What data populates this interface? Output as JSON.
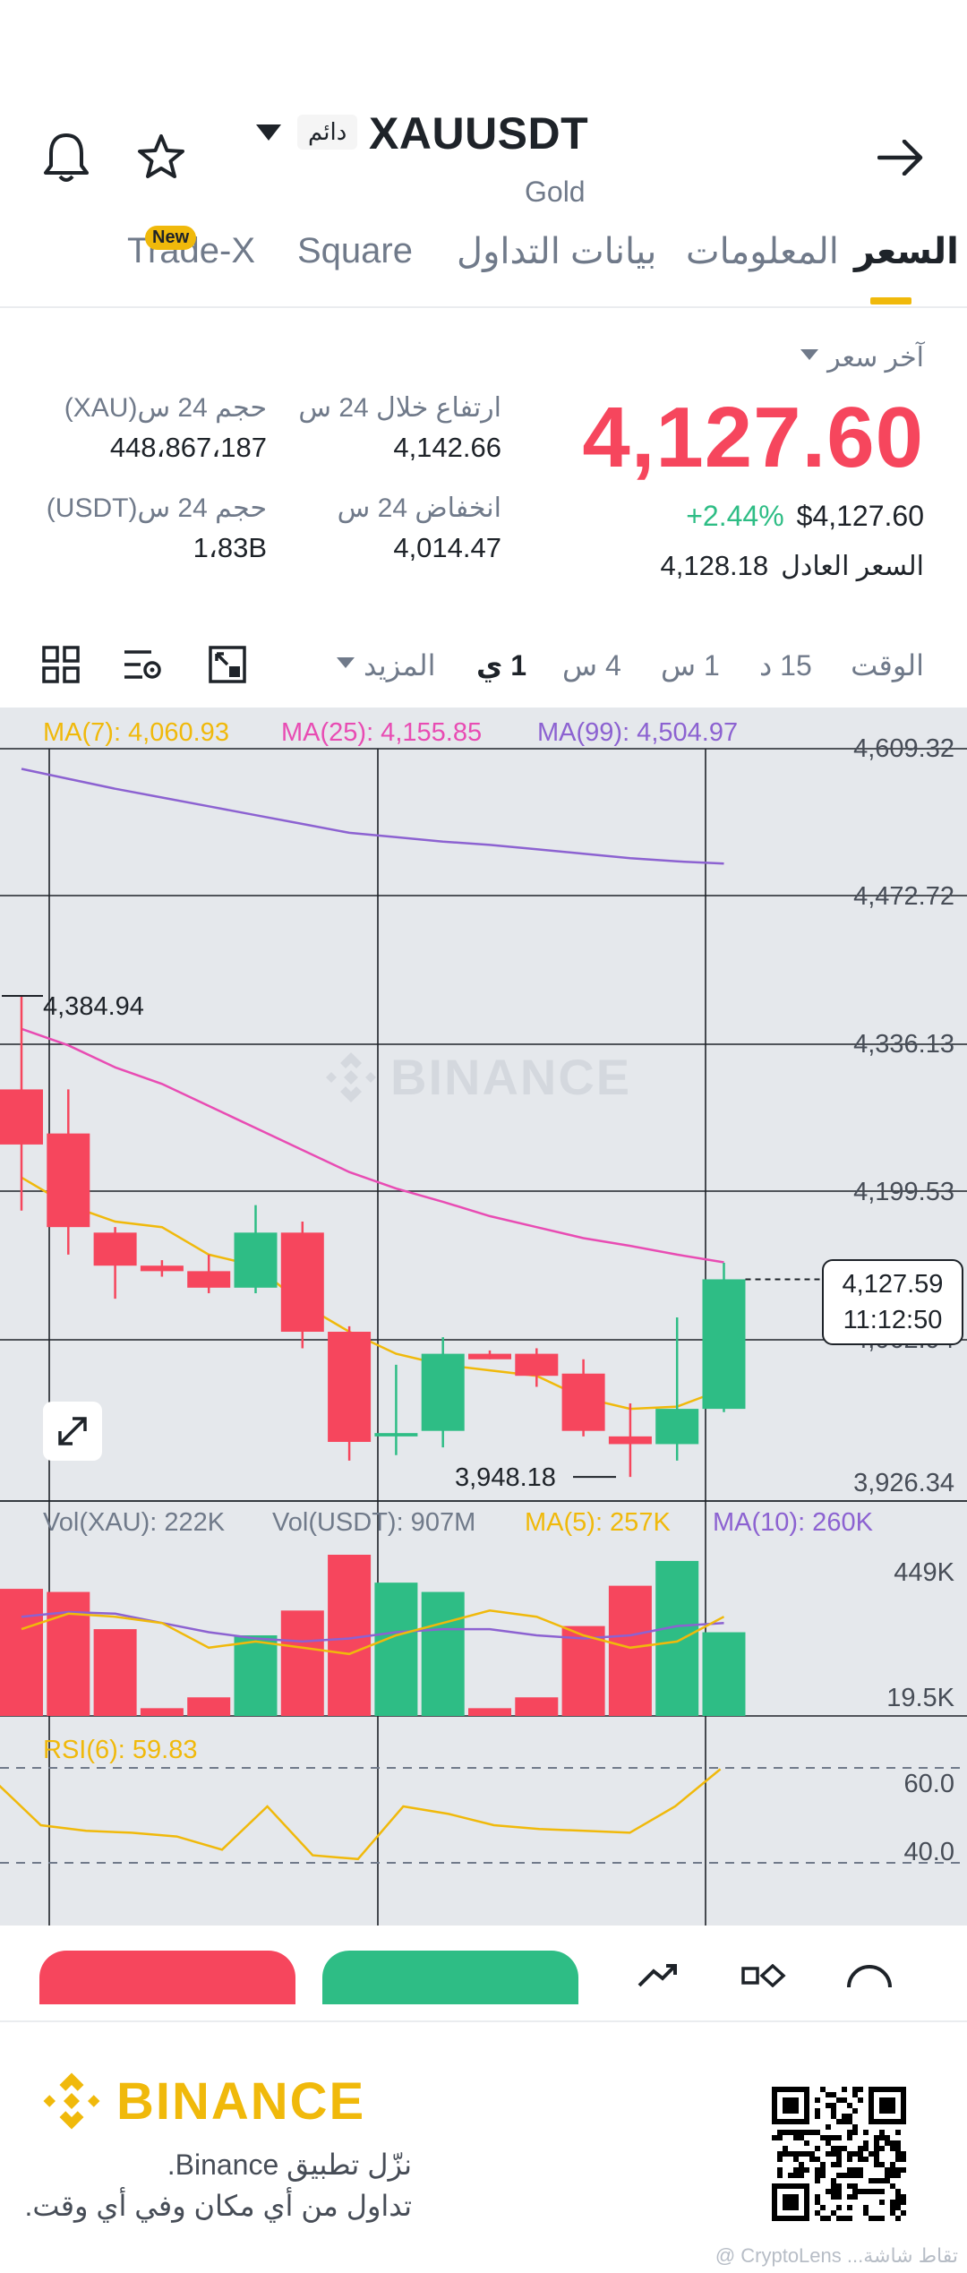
{
  "header": {
    "symbol": "XAUUSDT",
    "badge": "دائم",
    "subtitle": "Gold",
    "icons": [
      "bell-icon",
      "star-icon",
      "dropdown-triangle-icon",
      "arrow-right-icon"
    ]
  },
  "tabs": [
    {
      "label": "السعر",
      "active": true
    },
    {
      "label": "المعلومات",
      "active": false
    },
    {
      "label": "بيانات التداول",
      "active": false
    },
    {
      "label": "Square",
      "active": false
    },
    {
      "label": "Trade-X",
      "active": false,
      "badge": "New"
    }
  ],
  "price": {
    "last_price_label": "آخر سعر",
    "last_price": "4,127.60",
    "change_pct": "+2.44%",
    "usd_value": "$4,127.60",
    "fair_price_label": "السعر العادل",
    "fair_price": "4,128.18"
  },
  "stats": {
    "high_label": "ارتفاع خلال 24 س",
    "high_value": "4,142.66",
    "low_label": "انخفاض 24 س",
    "low_value": "4,014.47",
    "vol_xau_label": "حجم 24 س(XAU)",
    "vol_xau_value": "448،867،187",
    "vol_usdt_label": "حجم 24 س(USDT)",
    "vol_usdt_value": "1،83B"
  },
  "timeframes": {
    "time_label": "الوقت",
    "items": [
      "15 د",
      "1 س",
      "4 س",
      "1 ي",
      "المزيد"
    ],
    "active": "1 ي"
  },
  "chart_data": {
    "type": "candlestick",
    "watermark": "BINANCE",
    "ma_legend": [
      {
        "label": "MA(7): 4,060.93",
        "color": "#f0b90b"
      },
      {
        "label": "MA(25): 4,155.85",
        "color": "#e84cb3"
      },
      {
        "label": "MA(99): 4,504.97",
        "color": "#8c62d1"
      }
    ],
    "y_ticks": [
      "4,609.32",
      "4,472.72",
      "4,336.13",
      "4,199.53",
      "4,062.94",
      "3,926.34"
    ],
    "high_marker": "4,384.94",
    "low_marker": "3,948.18",
    "current_price_label": "4,127.59",
    "countdown": "11:12:50",
    "ylim": [
      3926.34,
      4609.32
    ],
    "candles": [
      {
        "o": 4300,
        "h": 4385,
        "l": 4190,
        "c": 4250
      },
      {
        "o": 4260,
        "h": 4300,
        "l": 4150,
        "c": 4175
      },
      {
        "o": 4170,
        "h": 4175,
        "l": 4110,
        "c": 4140
      },
      {
        "o": 4140,
        "h": 4145,
        "l": 4130,
        "c": 4135
      },
      {
        "o": 4135,
        "h": 4150,
        "l": 4115,
        "c": 4120
      },
      {
        "o": 4120,
        "h": 4195,
        "l": 4115,
        "c": 4170
      },
      {
        "o": 4170,
        "h": 4180,
        "l": 4065,
        "c": 4080
      },
      {
        "o": 4080,
        "h": 4085,
        "l": 3963,
        "c": 3980
      },
      {
        "o": 3985,
        "h": 4050,
        "l": 3968,
        "c": 3988
      },
      {
        "o": 3990,
        "h": 4075,
        "l": 3975,
        "c": 4060
      },
      {
        "o": 4060,
        "h": 4063,
        "l": 4055,
        "c": 4055
      },
      {
        "o": 4060,
        "h": 4065,
        "l": 4030,
        "c": 4040
      },
      {
        "o": 4042,
        "h": 4055,
        "l": 3985,
        "c": 3990
      },
      {
        "o": 3985,
        "h": 4015,
        "l": 3948.18,
        "c": 3978
      },
      {
        "o": 3978,
        "h": 4093,
        "l": 3963,
        "c": 4010
      },
      {
        "o": 4010,
        "h": 4142.66,
        "l": 4007,
        "c": 4127.6
      }
    ],
    "ma7": [
      4220,
      4195,
      4180,
      4175,
      4150,
      4140,
      4105,
      4080,
      4060,
      4050,
      4045,
      4040,
      4020,
      4010,
      4012,
      4028
    ],
    "ma25": [
      4355,
      4340,
      4320,
      4305,
      4285,
      4265,
      4245,
      4225,
      4210,
      4198,
      4185,
      4175,
      4165,
      4158,
      4150,
      4143
    ],
    "ma99": [
      4591,
      4582,
      4573,
      4565,
      4557,
      4549,
      4541,
      4533,
      4529,
      4525,
      4522,
      4518,
      4514,
      4510,
      4507,
      4504.97
    ],
    "volume_legend": [
      {
        "label": "Vol(XAU): 222K",
        "color": "#707a8a"
      },
      {
        "label": "Vol(USDT): 907M",
        "color": "#707a8a"
      },
      {
        "label": "MA(5): 257K",
        "color": "#f0b90b"
      },
      {
        "label": "MA(10): 260K",
        "color": "#8c62d1"
      }
    ],
    "volume_ticks": [
      "449K",
      "19.5K"
    ],
    "volume": [
      410,
      400,
      280,
      25,
      60,
      260,
      340,
      520,
      430,
      400,
      25,
      60,
      290,
      420,
      500,
      270
    ],
    "vol_ma5": [
      280,
      330,
      320,
      300,
      220,
      240,
      220,
      200,
      260,
      300,
      340,
      320,
      260,
      220,
      240,
      320
    ],
    "vol_ma10": [
      320,
      335,
      330,
      300,
      270,
      250,
      240,
      250,
      270,
      280,
      280,
      260,
      250,
      260,
      290,
      300
    ],
    "rsi_legend": {
      "label": "RSI(6): 59.83",
      "color": "#f0b90b"
    },
    "rsi_ticks": [
      "60.0",
      "40.0"
    ],
    "rsi": [
      53,
      30,
      27,
      26,
      24,
      17,
      40,
      14,
      12,
      40,
      36,
      30,
      28,
      27,
      26,
      40,
      59.83
    ]
  },
  "footer": {
    "brand": "BINANCE",
    "line1": "نزّل تطبيق Binance.",
    "line2": "تداول من أي مكان وفي أي وقت.",
    "watermark_credit": "@ CryptoLens ...تقاط شاشة"
  }
}
